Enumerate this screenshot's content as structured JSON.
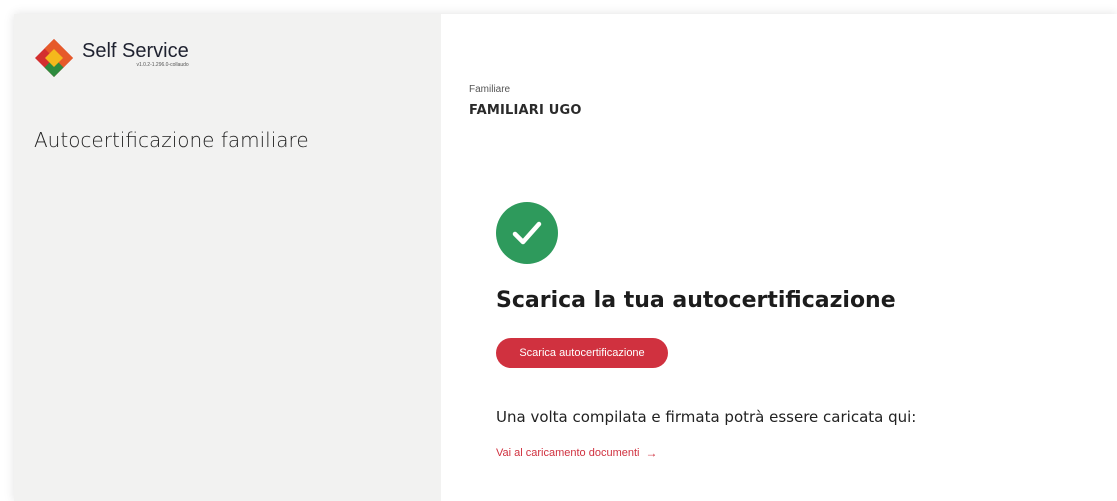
{
  "brand": {
    "name": "Self Service",
    "version": "v1.0.2-1.296.0-collaudo"
  },
  "sidebar": {
    "title": "Autocertificazione familiare"
  },
  "main": {
    "familiar_label": "Familiare",
    "familiar_name": "FAMILIARI UGO",
    "heading": "Scarica la tua autocertificazione",
    "download_button": "Scarica autocertificazione",
    "info_text": "Una volta compilata e firmata potrà essere caricata qui:",
    "upload_link": "Vai al caricamento documenti",
    "upload_arrow_icon": "arrow-right-icon",
    "success_icon": "check-circle-icon"
  },
  "colors": {
    "accent": "#d0313f",
    "success": "#2e9a5c",
    "sidebar_bg": "#f2f2f1"
  }
}
